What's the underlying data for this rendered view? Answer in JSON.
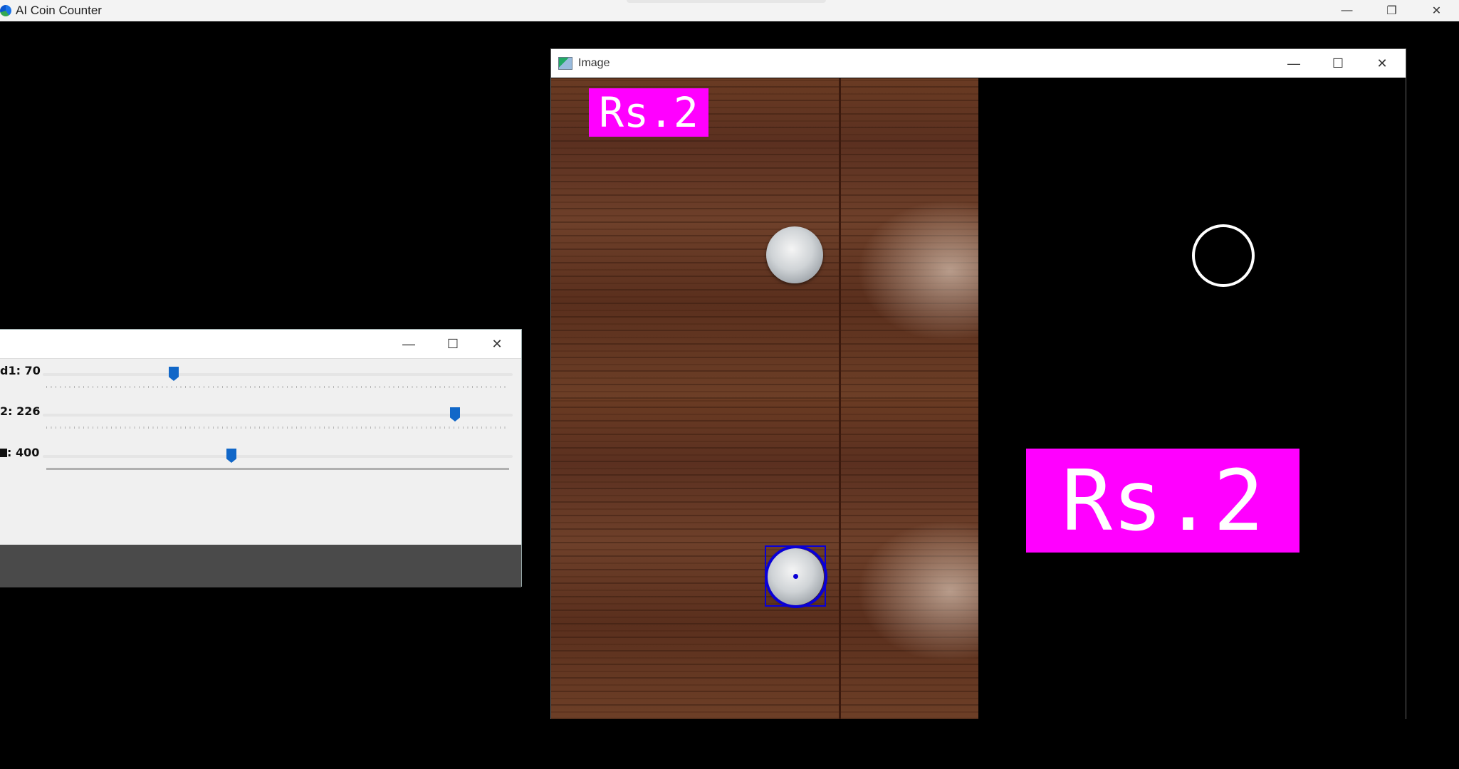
{
  "app": {
    "title": "AI Coin Counter",
    "controls": {
      "minimize": "—",
      "restore": "❐",
      "close": "✕"
    }
  },
  "trackbar_window": {
    "controls": {
      "minimize": "—",
      "maximize": "☐",
      "close": "✕"
    },
    "trackbars": [
      {
        "label": "d1: 70",
        "value": 70,
        "max": 255,
        "ticks": "dotted"
      },
      {
        "label": "2: 226",
        "value": 226,
        "max": 255,
        "ticks": "dotted"
      },
      {
        "label": ": 400",
        "value": 400,
        "max": 1000,
        "ticks": "solid"
      }
    ]
  },
  "image_window": {
    "title": "Image",
    "icon": "image-window-icon",
    "controls": {
      "minimize": "—",
      "maximize": "☐",
      "close": "✕"
    },
    "top_label": "Rs.2",
    "result_label": "Rs.2",
    "colors": {
      "label_bg": "#ff00ff",
      "detection": "#0a00d6",
      "edge": "#ffffff"
    }
  }
}
